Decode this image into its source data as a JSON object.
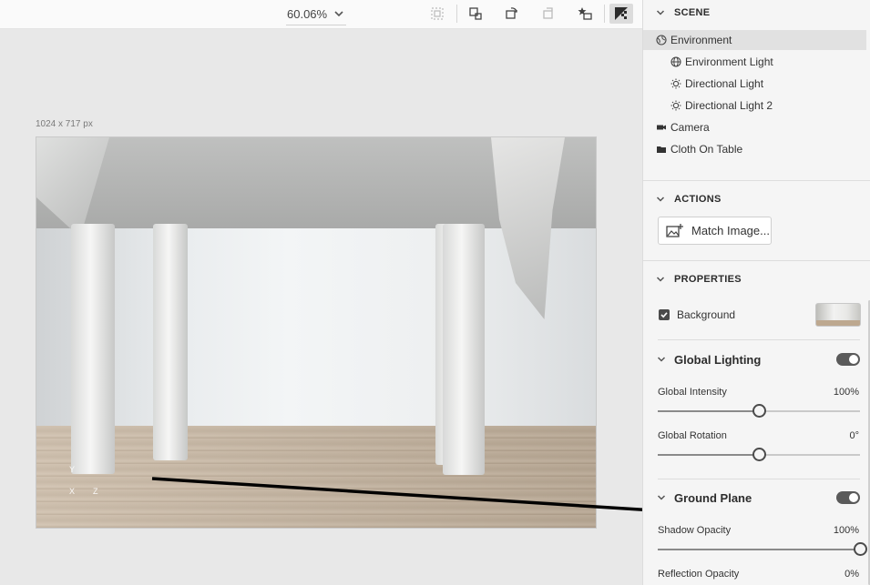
{
  "toolbar": {
    "zoom_value": "60.06%",
    "tools": [
      {
        "name": "fit-canvas-icon",
        "active": false,
        "disabled": true
      },
      {
        "name": "render-region-icon",
        "active": false,
        "disabled": false
      },
      {
        "name": "rotate-view-icon",
        "active": false,
        "disabled": false
      },
      {
        "name": "reset-view-icon",
        "active": false,
        "disabled": true
      },
      {
        "name": "favorite-view-icon",
        "active": false,
        "disabled": false
      },
      {
        "name": "render-preview-icon",
        "active": true,
        "disabled": false
      }
    ]
  },
  "canvas": {
    "dimensions_label": "1024 x 717 px",
    "axis_y": "Y",
    "axis_x": "X",
    "axis_z": "Z"
  },
  "scene": {
    "header": "SCENE",
    "items": [
      {
        "label": "Environment",
        "icon": "environment-icon",
        "selected": true
      },
      {
        "label": "Environment Light",
        "icon": "globe-icon",
        "selected": false
      },
      {
        "label": "Directional Light",
        "icon": "sun-icon",
        "selected": false
      },
      {
        "label": "Directional Light 2",
        "icon": "sun-icon",
        "selected": false
      },
      {
        "label": "Camera",
        "icon": "camera-icon",
        "selected": false
      },
      {
        "label": "Cloth On Table",
        "icon": "folder-icon",
        "selected": false
      }
    ]
  },
  "actions": {
    "header": "ACTIONS",
    "match_image_label": "Match Image..."
  },
  "properties": {
    "header": "PROPERTIES",
    "background_label": "Background",
    "background_checked": true,
    "global_lighting": {
      "title": "Global Lighting",
      "enabled": true,
      "intensity_label": "Global Intensity",
      "intensity_value": "100%",
      "intensity_level": 0.5,
      "rotation_label": "Global Rotation",
      "rotation_value": "0°",
      "rotation_level": 0.5
    },
    "ground_plane": {
      "title": "Ground Plane",
      "enabled": true,
      "shadow_label": "Shadow Opacity",
      "shadow_value": "100%",
      "shadow_level": 1.0,
      "reflection_label": "Reflection Opacity",
      "reflection_value": "0%"
    }
  },
  "colors": {
    "panel_bg": "#f5f5f5",
    "selected_row": "#e1e1e1",
    "toggle_on": "#5a5a5a",
    "accent_dark": "#4b4b4b"
  }
}
